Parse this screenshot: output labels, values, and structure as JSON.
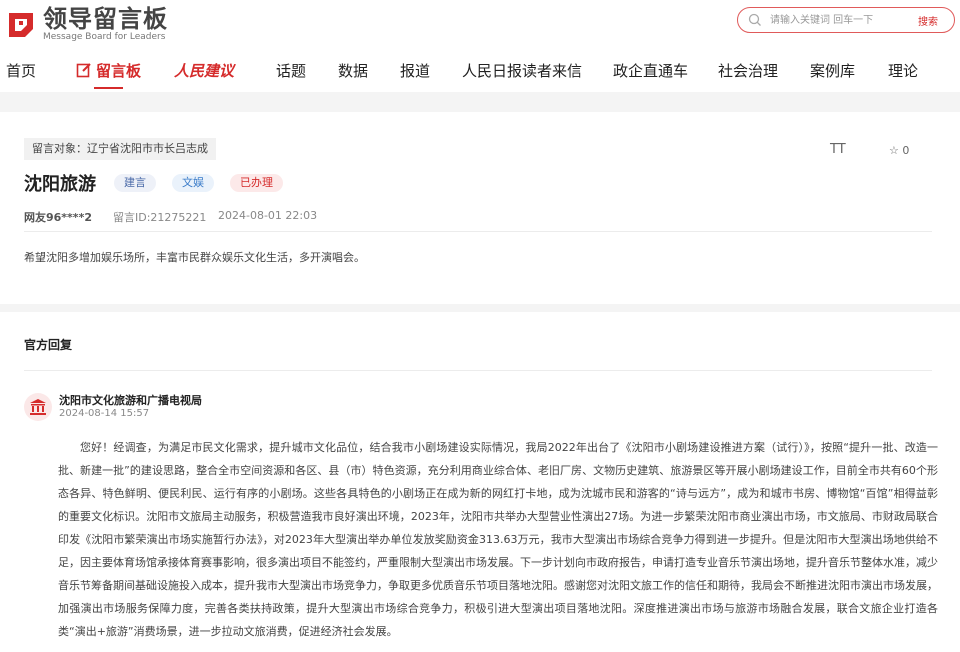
{
  "header": {
    "logo_cn": "领导留言板",
    "logo_en": "Message Board for Leaders",
    "search_placeholder": "请输入关键词 回车一下",
    "search_button": "搜索"
  },
  "nav": [
    {
      "label": "首页"
    },
    {
      "label": "留言板"
    },
    {
      "label": "人民建议"
    },
    {
      "label": "话题"
    },
    {
      "label": "数据"
    },
    {
      "label": "报道"
    },
    {
      "label": "人民日报读者来信"
    },
    {
      "label": "政企直通车"
    },
    {
      "label": "社会治理"
    },
    {
      "label": "案例库"
    },
    {
      "label": "理论"
    }
  ],
  "message": {
    "target": "留言对象：辽宁省沈阳市市长吕志成",
    "title": "沈阳旅游",
    "tags": [
      "建言",
      "文娱",
      "已办理"
    ],
    "author": "网友96****2",
    "message_id": "留言ID:21275221",
    "time": "2024-08-01 22:03",
    "font_size_label": "TT",
    "star_count": "☆ 0",
    "content": "希望沈阳多增加娱乐场所，丰富市民群众娱乐文化生活，多开演唱会。"
  },
  "reply": {
    "heading": "官方回复",
    "department": "沈阳市文化旅游和广播电视局",
    "date": "2024-08-14 15:57",
    "body": "您好！经调查，为满足市民文化需求，提升城市文化品位，结合我市小剧场建设实际情况，我局2022年出台了《沈阳市小剧场建设推进方案（试行）》，按照“提升一批、改造一批、新建一批”的建设思路，整合全市空间资源和各区、县（市）特色资源，充分利用商业综合体、老旧厂房、文物历史建筑、旅游景区等开展小剧场建设工作，目前全市共有60个形态各异、特色鲜明、便民利民、运行有序的小剧场。这些各具特色的小剧场正在成为新的网红打卡地，成为沈城市民和游客的“诗与远方”，成为和城市书房、博物馆“百馆”相得益彰的重要文化标识。沈阳市文旅局主动服务，积极营造我市良好演出环境，2023年，沈阳市共举办大型营业性演出27场。为进一步繁荣沈阳市商业演出市场，市文旅局、市财政局联合印发《沈阳市繁荣演出市场实施暂行办法》，对2023年大型演出举办单位发放奖励资金313.63万元，我市大型演出市场综合竞争力得到进一步提升。但是沈阳市大型演出场地供给不足，因主要体育场馆承接体育赛事影响，很多演出项目不能签约，严重限制大型演出市场发展。下一步计划向市政府报告，申请打造专业音乐节演出场地，提升音乐节整体水准，减少音乐节筹备期间基础设施投入成本，提升我市大型演出市场竞争力，争取更多优质音乐节项目落地沈阳。感谢您对沈阳文旅工作的信任和期待，我局会不断推进沈阳市演出市场发展，加强演出市场服务保障力度，完善各类扶持政策，提升大型演出市场综合竞争力，积极引进大型演出项目落地沈阳。深度推进演出市场与旅游市场融合发展，联合文旅企业打造各类“演出+旅游”消费场景，进一步拉动文旅消费，促进经济社会发展。"
  },
  "colors": {
    "accent": "#d52b2b",
    "page_bg": "#f4f4f4"
  }
}
